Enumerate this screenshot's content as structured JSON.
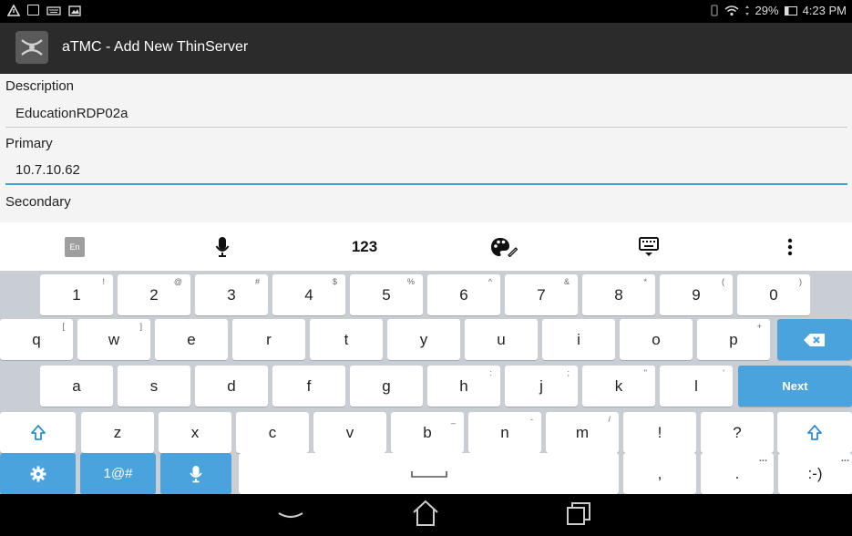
{
  "status_bar": {
    "battery_percent": "29%",
    "time": "4:23 PM"
  },
  "action_bar": {
    "title": "aTMC - Add New ThinServer",
    "app_icon": "thinmanager-logo-icon"
  },
  "form": {
    "description": {
      "label": "Description",
      "value": "EducationRDP02a"
    },
    "primary": {
      "label": "Primary",
      "value": "10.7.10.62"
    },
    "secondary": {
      "label": "Secondary",
      "value": ""
    }
  },
  "keyboard_toolbar": {
    "language": "En",
    "numbers_label": "123",
    "icons": [
      "microphone-icon",
      "palette-icon",
      "keyboard-hide-icon",
      "more-vert-icon"
    ]
  },
  "keyboard": {
    "row1": [
      {
        "key": "1",
        "hint": "!"
      },
      {
        "key": "2",
        "hint": "@"
      },
      {
        "key": "3",
        "hint": "#"
      },
      {
        "key": "4",
        "hint": "$"
      },
      {
        "key": "5",
        "hint": "%"
      },
      {
        "key": "6",
        "hint": "^"
      },
      {
        "key": "7",
        "hint": "&"
      },
      {
        "key": "8",
        "hint": "*"
      },
      {
        "key": "9",
        "hint": "("
      },
      {
        "key": "0",
        "hint": ")"
      }
    ],
    "row2": [
      {
        "key": "q",
        "hint": "["
      },
      {
        "key": "w",
        "hint": "]"
      },
      {
        "key": "e",
        "hint": ""
      },
      {
        "key": "r",
        "hint": ""
      },
      {
        "key": "t",
        "hint": ""
      },
      {
        "key": "y",
        "hint": ""
      },
      {
        "key": "u",
        "hint": ""
      },
      {
        "key": "i",
        "hint": ""
      },
      {
        "key": "o",
        "hint": ""
      },
      {
        "key": "p",
        "hint": "+"
      }
    ],
    "row3": [
      {
        "key": "a",
        "hint": ""
      },
      {
        "key": "s",
        "hint": ""
      },
      {
        "key": "d",
        "hint": ""
      },
      {
        "key": "f",
        "hint": ""
      },
      {
        "key": "g",
        "hint": ""
      },
      {
        "key": "h",
        "hint": ":"
      },
      {
        "key": "j",
        "hint": ";"
      },
      {
        "key": "k",
        "hint": "\""
      },
      {
        "key": "l",
        "hint": "'"
      }
    ],
    "row4": [
      {
        "key": "z",
        "hint": ""
      },
      {
        "key": "x",
        "hint": ""
      },
      {
        "key": "c",
        "hint": ""
      },
      {
        "key": "v",
        "hint": ""
      },
      {
        "key": "b",
        "hint": "_"
      },
      {
        "key": "n",
        "hint": "-"
      },
      {
        "key": "m",
        "hint": "/"
      },
      {
        "key": "!",
        "hint": ""
      },
      {
        "key": "?",
        "hint": ""
      }
    ],
    "next_label": "Next",
    "symbols_label": "1@#",
    "comma": ",",
    "period": ".",
    "period_hint": "...",
    "smiley": ":-)",
    "smiley_hint": "...",
    "accent_color": "#4aa3dc"
  }
}
